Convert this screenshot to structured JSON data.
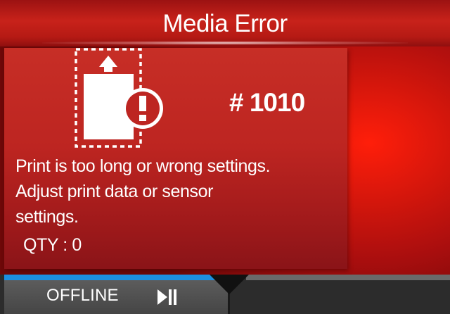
{
  "screen": {
    "title": "Media Error",
    "error_code": "# 1010",
    "message_lines": [
      "Print is too long or wrong settings.",
      "Adjust print data or sensor",
      "settings."
    ],
    "quantity": "QTY : 0",
    "icon": "media-error-icon",
    "colors": {
      "background_red": "#d8170c",
      "panel_red": "#bd2521",
      "text": "#ffffff"
    }
  },
  "status_bar": {
    "mode_label": "OFFLINE",
    "mode_icon": "play-pause-icon",
    "colors": {
      "online_accent": "#1c8fe0",
      "bar": "#2c2c2c"
    }
  }
}
